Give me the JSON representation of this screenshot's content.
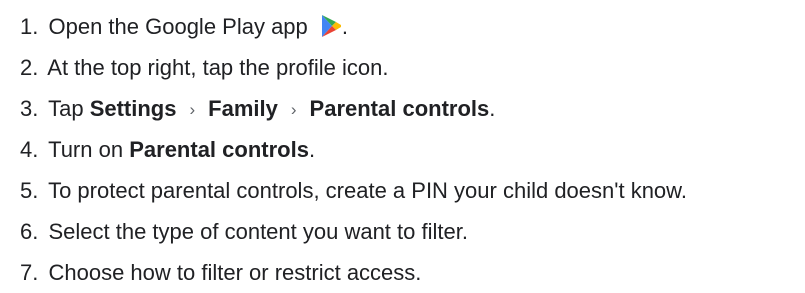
{
  "steps": [
    {
      "number": "1.",
      "text_before_icon": "Open the Google Play app",
      "icon": "google-play-icon",
      "text_after_icon": "."
    },
    {
      "number": "2.",
      "text": "At the top right, tap the profile icon."
    },
    {
      "number": "3.",
      "prefix": "Tap",
      "path": [
        "Settings",
        "Family",
        "Parental controls"
      ],
      "separator": "›",
      "suffix": "."
    },
    {
      "number": "4.",
      "prefix": "Turn on",
      "bold": "Parental controls",
      "suffix": "."
    },
    {
      "number": "5.",
      "text": "To protect parental controls, create a PIN your child doesn't know."
    },
    {
      "number": "6.",
      "text": "Select the type of content you want to filter."
    },
    {
      "number": "7.",
      "text": "Choose how to filter or restrict access."
    }
  ],
  "colors": {
    "text": "#202124",
    "separator": "#5f6368",
    "play_blue": "#4285F4",
    "play_green": "#34A853",
    "play_yellow": "#FBBC04",
    "play_red": "#EA4335"
  }
}
